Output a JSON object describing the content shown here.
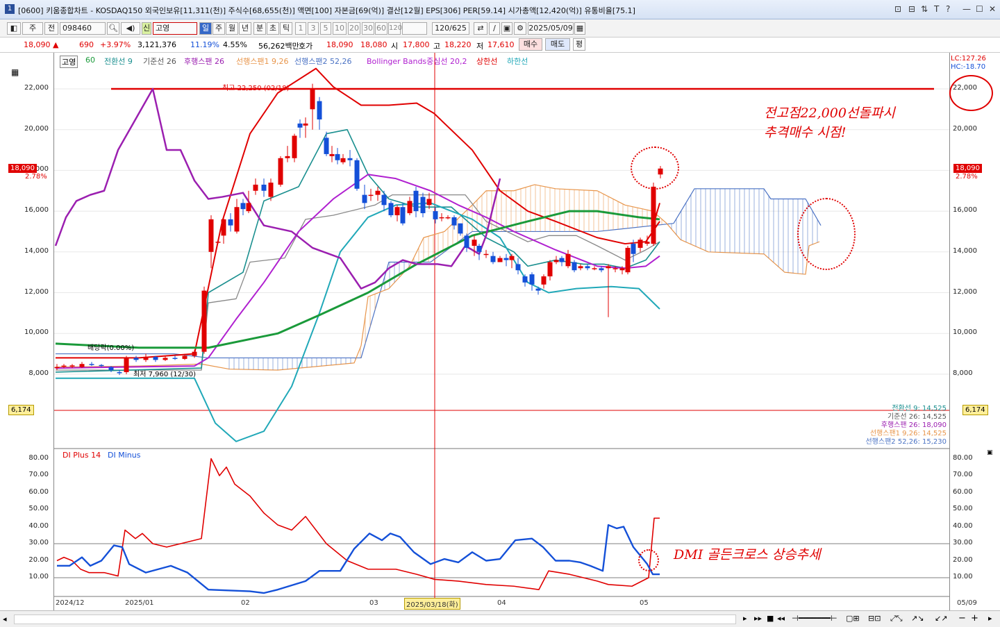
{
  "window": {
    "number": "1",
    "title": "[0600] 키움종합차트 - KOSDAQ150 외국인보유[11,311(천)] 주식수[68,655(천)] 액면[100] 자본금[69(억)] 결산[12월] EPS[306] PER[59.14] 시가총액[12,420(억)] 유통비율[75.1]"
  },
  "toolbar": {
    "period_main": "주",
    "period_sub": "전",
    "code": "098460",
    "stock_badge": "신",
    "stock_name": "고영",
    "periods": [
      "일",
      "주",
      "월",
      "년",
      "분",
      "초",
      "틱"
    ],
    "minutes": [
      "1",
      "3",
      "5",
      "10",
      "20",
      "30",
      "60",
      "120"
    ],
    "count": "120/625",
    "date": "2025/05/09"
  },
  "quote": {
    "price": "18,090",
    "change": "690",
    "change_pct": "+3.97%",
    "volume": "3,121,376",
    "turnover": "11.19%",
    "vol_ratio": "4.55%",
    "amount": "56,262백만",
    "hoga_label": "호가",
    "ask": "18,090",
    "bid": "18,080",
    "open_label": "시",
    "open": "17,800",
    "high_label": "고",
    "high": "18,220",
    "low_label": "저",
    "low": "17,610",
    "buy_btn": "매수",
    "sell_btn": "매도",
    "avg_btn": "평"
  },
  "legend_top": {
    "stock": "고영",
    "ma": "60",
    "tenkan": "전환선 9",
    "kijun": "기준선 26",
    "chikou": "후행스팬 26",
    "span1": "선행스팬1 9,26",
    "span2": "선행스팬2 52,26",
    "bb_mid": "Bollinger Bands중심선 20,2",
    "bb_up": "상한선",
    "bb_low": "하한선"
  },
  "right_info": {
    "lc": "LC:127.26",
    "hc": "HC:-18.70"
  },
  "price_axis": [
    "22,000",
    "20,000",
    "18,000",
    "16,000",
    "14,000",
    "12,000",
    "10,000",
    "8,000"
  ],
  "indicator_axis": [
    "80.00",
    "70.00",
    "60.00",
    "50.00",
    "40.00",
    "30.00",
    "20.00",
    "10.00"
  ],
  "price_flag": {
    "value": "18,090",
    "pct": "2.78%"
  },
  "yellow_flag": "6,174",
  "high_mark": "최고 22,250 (02/18)",
  "low_mark": "최저 7,960 (12/30)",
  "dividend_mark": "배당락(0.00%)",
  "values_box": [
    {
      "text": "전환선 9: 14,525",
      "color": "#1a8f8f"
    },
    {
      "text": "기준선 26: 14,525",
      "color": "#555555"
    },
    {
      "text": "후행스팬 26: 18,090",
      "color": "#9b1fb0"
    },
    {
      "text": "선행스팬1 9,26: 14,525",
      "color": "#e8954a"
    },
    {
      "text": "선행스팬2 52,26: 15,230",
      "color": "#4a72c4"
    }
  ],
  "legend_bottom": {
    "plus": "DI Plus 14",
    "minus": "DI Minus"
  },
  "x_axis": [
    "2024/12",
    "2025/01",
    "02",
    "03",
    "2025/03/18(화)",
    "04",
    "05",
    "05/09"
  ],
  "annotations": {
    "top1": "전고점22,000선돌파시",
    "top2": "추격매수 시점!",
    "bottom": "DMI 골든크로스 상승추세"
  },
  "colors": {
    "up": "#e00000",
    "down": "#1450d8",
    "ma60": "#1a9a3a",
    "bb": "#b020d0",
    "bb_band": "#20a8b8"
  }
}
